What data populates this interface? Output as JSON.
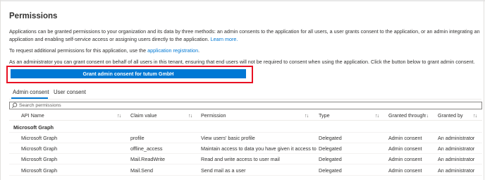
{
  "title": "Permissions",
  "intro": {
    "text": "Applications can be granted permissions to your organization and its data by three methods: an admin consents to the application for all users, a user grants consent to the application, or an admin integrating an application and enabling self-service access or assigning users directly to the application.",
    "learn_more": "Learn more."
  },
  "request": {
    "text": "To request additional permissions for this application, use the",
    "link": "application registration",
    "suffix": "."
  },
  "admin_note": "As an administrator you can grant consent on behalf of all users in this tenant, ensuring that end users will not be required to consent when using the application. Click the button below to grant admin consent.",
  "grant_button": "Grant admin consent for tutum GmbH",
  "tabs": [
    {
      "label": "Admin consent",
      "selected": true
    },
    {
      "label": "User consent",
      "selected": false
    }
  ],
  "search": {
    "placeholder": "Search permissions",
    "icon": "search-icon"
  },
  "columns": [
    "API Name",
    "Claim value",
    "Permission",
    "Type",
    "Granted through",
    "Granted by"
  ],
  "sort_icon": "↑↓",
  "group": "Microsoft Graph",
  "rows": [
    {
      "api": "Microsoft Graph",
      "claim": "profile",
      "permission": "View users' basic profile",
      "type": "Delegated",
      "through": "Admin consent",
      "by": "An administrator"
    },
    {
      "api": "Microsoft Graph",
      "claim": "offline_access",
      "permission": "Maintain access to data you have given it access to",
      "type": "Delegated",
      "through": "Admin consent",
      "by": "An administrator"
    },
    {
      "api": "Microsoft Graph",
      "claim": "Mail.ReadWrite",
      "permission": "Read and write access to user mail",
      "type": "Delegated",
      "through": "Admin consent",
      "by": "An administrator"
    },
    {
      "api": "Microsoft Graph",
      "claim": "Mail.Send",
      "permission": "Send mail as a user",
      "type": "Delegated",
      "through": "Admin consent",
      "by": "An administrator"
    }
  ],
  "colors": {
    "accent": "#0078d4",
    "highlight": "#e81123",
    "text": "#323130"
  }
}
